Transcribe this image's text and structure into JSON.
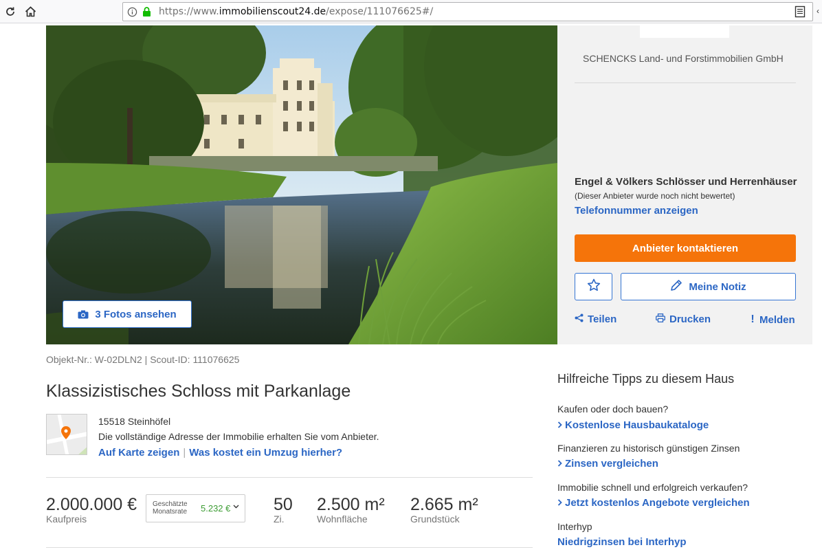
{
  "browser": {
    "url_prefix": "https://www.",
    "url_domain": "immobilienscout24.de",
    "url_path": "/expose/111076625#/",
    "reload_icon": "reload-icon",
    "home_icon": "home-icon",
    "info_icon": "info-icon",
    "lock_icon": "lock-icon",
    "reader_icon": "reader-view-icon"
  },
  "gallery": {
    "photos_button_label": "3 Fotos ansehen",
    "camera_icon": "camera-icon"
  },
  "contact": {
    "agency_name": "SCHENCKS Land- und Forstimmobilien GmbH",
    "provider_name": "Engel & Völkers Schlösser und Herrenhäuser",
    "provider_rating": "(Dieser Anbieter wurde noch nicht bewertet)",
    "phone_link": "Telefonnummer anzeigen",
    "contact_button": "Anbieter kontaktieren",
    "note_button": "Meine Notiz",
    "share_label": "Teilen",
    "print_label": "Drucken",
    "report_label": "Melden"
  },
  "listing": {
    "object_ids": "Objekt-Nr.: W-02DLN2 | Scout-ID: 111076625",
    "title": "Klassizistisches Schloss mit Parkanlage",
    "postal_city": "15518 Steinhöfel",
    "address_note": "Die vollständige Adresse der Immobilie erhalten Sie vom Anbieter.",
    "map_link": "Auf Karte zeigen",
    "link_separator": "|",
    "moving_cost_link": "Was kostet ein Umzug hierher?"
  },
  "key_facts": {
    "price_value": "2.000.000 €",
    "price_label": "Kaufpreis",
    "rate_label": "Geschätzte Monatsrate",
    "rate_value": "5.232 €",
    "rooms_value": "50",
    "rooms_label": "Zi.",
    "living_area_value": "2.500 m²",
    "living_area_label": "Wohnfläche",
    "plot_value": "2.665 m²",
    "plot_label": "Grundstück"
  },
  "tips": {
    "title": "Hilfreiche Tipps zu diesem Haus",
    "items": [
      {
        "text": "Kaufen oder doch bauen?",
        "link": "Kostenlose Hausbaukataloge"
      },
      {
        "text": "Finanzieren zu historisch günstigen Zinsen",
        "link": "Zinsen vergleichen"
      },
      {
        "text": "Immobilie schnell und erfolgreich verkaufen?",
        "link": "Jetzt kostenlos Angebote vergleichen"
      },
      {
        "text": "Interhyp",
        "link": "Niedrigzinsen bei Interhyp"
      }
    ]
  },
  "colors": {
    "link_blue": "#2b66c4",
    "cta_orange": "#f5740a",
    "rate_green": "#3c9c33",
    "panel_gray": "#f2f2f2"
  }
}
